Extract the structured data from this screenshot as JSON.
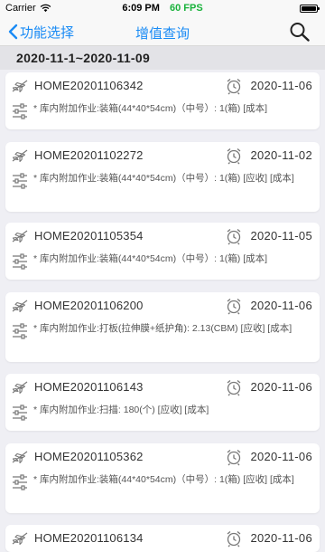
{
  "status_bar": {
    "carrier": "Carrier",
    "time": "6:09 PM",
    "fps": "60 FPS"
  },
  "nav": {
    "back_label": "功能选择",
    "title": "增值查询",
    "back_icon": "chevron-left-icon",
    "search_icon": "search-icon"
  },
  "date_range": "2020-11-1~2020-11-09",
  "orders": [
    {
      "no": "HOME20201106342",
      "date": "2020-11-06",
      "desc": "* 库内附加作业:装箱(44*40*54cm)（中号）: 1(箱) [成本]"
    },
    {
      "no": "HOME20201102272",
      "date": "2020-11-02",
      "desc": "* 库内附加作业:装箱(44*40*54cm)（中号）: 1(箱) [应收] [成本]"
    },
    {
      "no": "HOME20201105354",
      "date": "2020-11-05",
      "desc": "* 库内附加作业:装箱(44*40*54cm)（中号）: 1(箱) [成本]"
    },
    {
      "no": "HOME20201106200",
      "date": "2020-11-06",
      "desc": "* 库内附加作业:打板(拉伸膜+纸护角): 2.13(CBM) [应收] [成本]"
    },
    {
      "no": "HOME20201106143",
      "date": "2020-11-06",
      "desc": "* 库内附加作业:扫描: 180(个) [应收] [成本]"
    },
    {
      "no": "HOME20201105362",
      "date": "2020-11-06",
      "desc": "* 库内附加作业:装箱(44*40*54cm)（中号）: 1(箱) [应收] [成本]"
    },
    {
      "no": "HOME20201106134",
      "date": "2020-11-06",
      "desc": ""
    }
  ],
  "colors": {
    "accent": "#1a8bf5",
    "fps": "#19b23b",
    "background": "#efeff4"
  }
}
